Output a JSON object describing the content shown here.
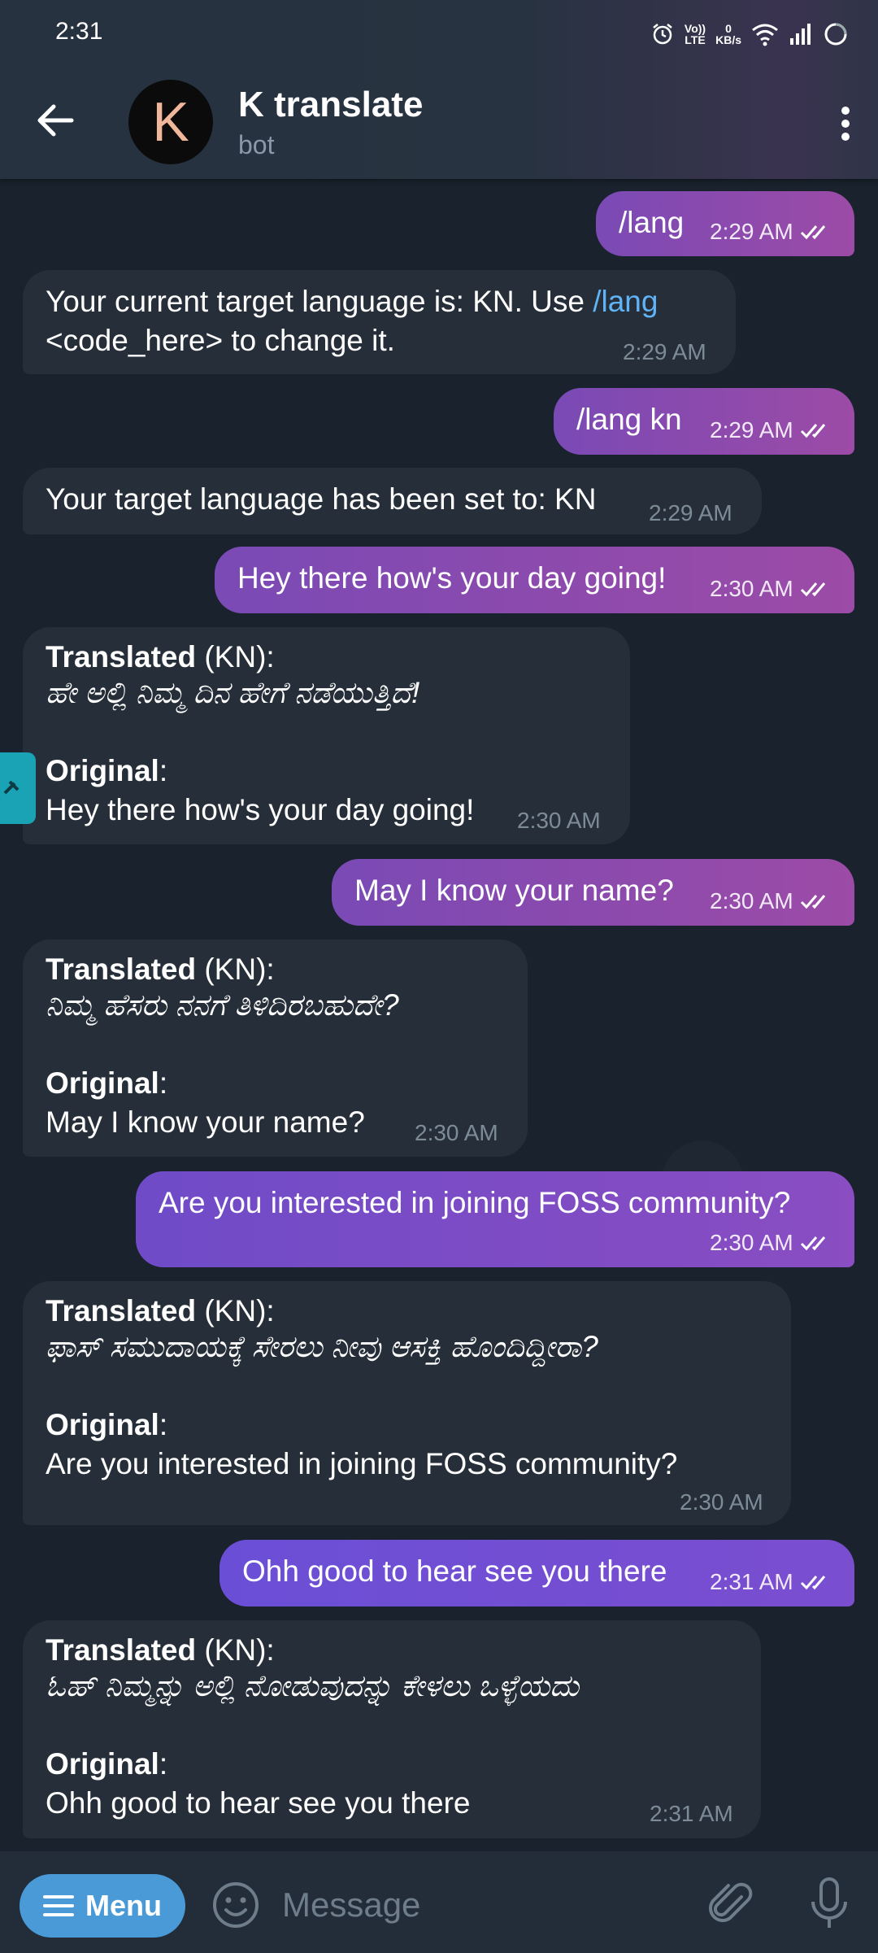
{
  "status_bar": {
    "time": "2:31",
    "lte_label": "LTE",
    "volte_label": "Vo))",
    "speed_value": "0",
    "speed_unit": "KB/s"
  },
  "header": {
    "title": "K translate",
    "subtitle": "bot",
    "avatar_letter": "K"
  },
  "messages": [
    {
      "dir": "out",
      "text": "/lang",
      "time": "2:29 AM"
    },
    {
      "dir": "in",
      "line1_pre": "Your current target language is: KN. Use ",
      "line1_link": "/lang",
      "line2": "<code_here> to change it.",
      "time": "2:29 AM"
    },
    {
      "dir": "out",
      "text": "/lang kn",
      "time": "2:29 AM"
    },
    {
      "dir": "in",
      "text": "Your target language has been set to: KN",
      "time": "2:29 AM"
    },
    {
      "dir": "out",
      "text": "Hey there how's your day going!",
      "time": "2:30 AM"
    },
    {
      "dir": "in",
      "translated_label": "Translated",
      "lang_tag": " (KN):",
      "translated_text": "ಹೇ ಅಲ್ಲಿ ನಿಮ್ಮ ದಿನ ಹೇಗೆ ನಡೆಯುತ್ತಿದೆ!",
      "original_label": "Original",
      "original_colon": ":",
      "original_text": "Hey there how's your day going!",
      "time": "2:30 AM"
    },
    {
      "dir": "out",
      "text": "May I know your name?",
      "time": "2:30 AM"
    },
    {
      "dir": "in",
      "translated_label": "Translated",
      "lang_tag": " (KN):",
      "translated_text": "ನಿಮ್ಮ ಹೆಸರು ನನಗೆ ತಿಳಿದಿರಬಹುದೇ?",
      "original_label": "Original",
      "original_colon": ":",
      "original_text": "May I know your name?",
      "time": "2:30 AM"
    },
    {
      "dir": "out",
      "text": "Are you interested in joining FOSS community?",
      "time": "2:30 AM"
    },
    {
      "dir": "in",
      "translated_label": "Translated",
      "lang_tag": " (KN):",
      "translated_text": "ಫಾಸ್ ಸಮುದಾಯಕ್ಕೆ ಸೇರಲು ನೀವು ಆಸಕ್ತಿ ಹೊಂದಿದ್ದೀರಾ?",
      "original_label": "Original",
      "original_colon": ":",
      "original_text": "Are you interested in joining FOSS community?",
      "time": "2:30 AM"
    },
    {
      "dir": "out",
      "text": "Ohh good to hear see you there",
      "time": "2:31 AM"
    },
    {
      "dir": "in",
      "translated_label": "Translated",
      "lang_tag": " (KN):",
      "translated_text": "ಓಹ್ ನಿಮ್ಮನ್ನು ಅಲ್ಲಿ ನೋಡುವುದನ್ನು ಕೇಳಲು ಒಳ್ಳೆಯದು",
      "original_label": "Original",
      "original_colon": ":",
      "original_text": "Ohh good to hear see you there",
      "time": "2:31 AM"
    }
  ],
  "input_bar": {
    "menu_label": "Menu",
    "placeholder": "Message"
  },
  "colors": {
    "outgoing_start": "#7a4ab5",
    "outgoing_end": "#9c4ba6",
    "incoming": "#262f39",
    "link": "#5fb3f6",
    "menu_button": "#4a9ad8"
  }
}
